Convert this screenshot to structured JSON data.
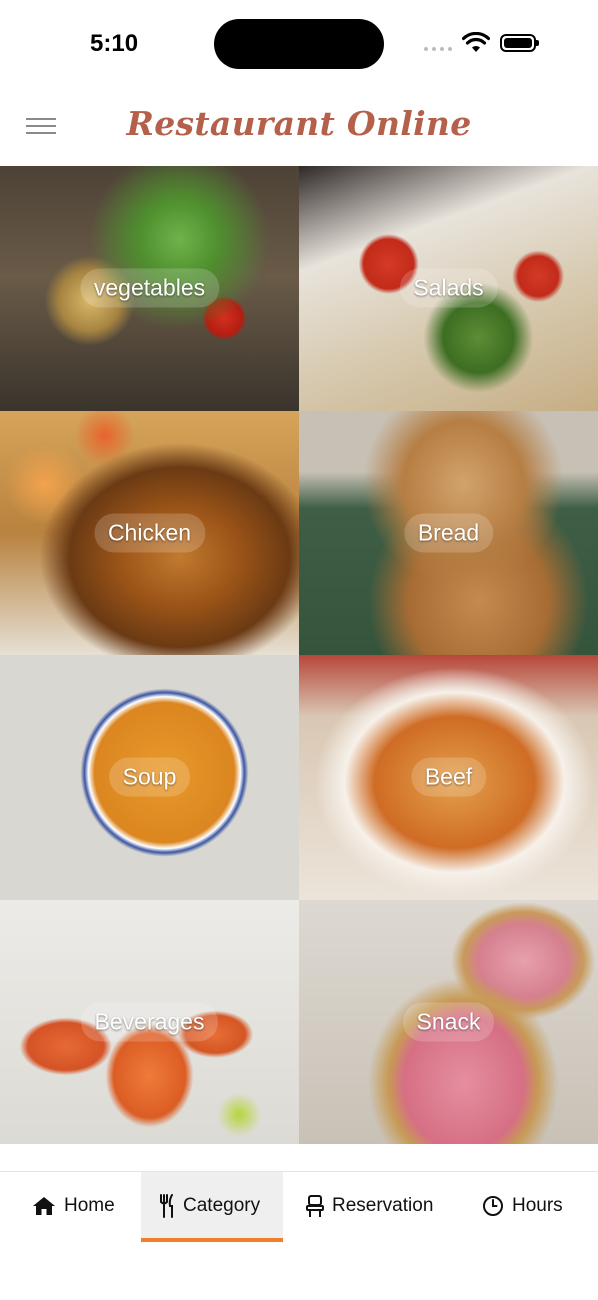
{
  "status_bar": {
    "time": "5:10"
  },
  "header": {
    "title": "Restaurant Online"
  },
  "categories": [
    {
      "label": "vegetables"
    },
    {
      "label": "Salads"
    },
    {
      "label": "Chicken"
    },
    {
      "label": "Bread"
    },
    {
      "label": "Soup"
    },
    {
      "label": "Beef"
    },
    {
      "label": "Beverages"
    },
    {
      "label": "Snack"
    }
  ],
  "nav": {
    "items": [
      {
        "label": "Home",
        "icon": "home-icon"
      },
      {
        "label": "Category",
        "icon": "fork-knife-icon",
        "active": true
      },
      {
        "label": "Reservation",
        "icon": "chair-icon"
      },
      {
        "label": "Hours",
        "icon": "clock-icon"
      }
    ]
  },
  "colors": {
    "accent": "#f07f2a",
    "title": "#b5604a",
    "active_tab_bg": "#efefef"
  }
}
